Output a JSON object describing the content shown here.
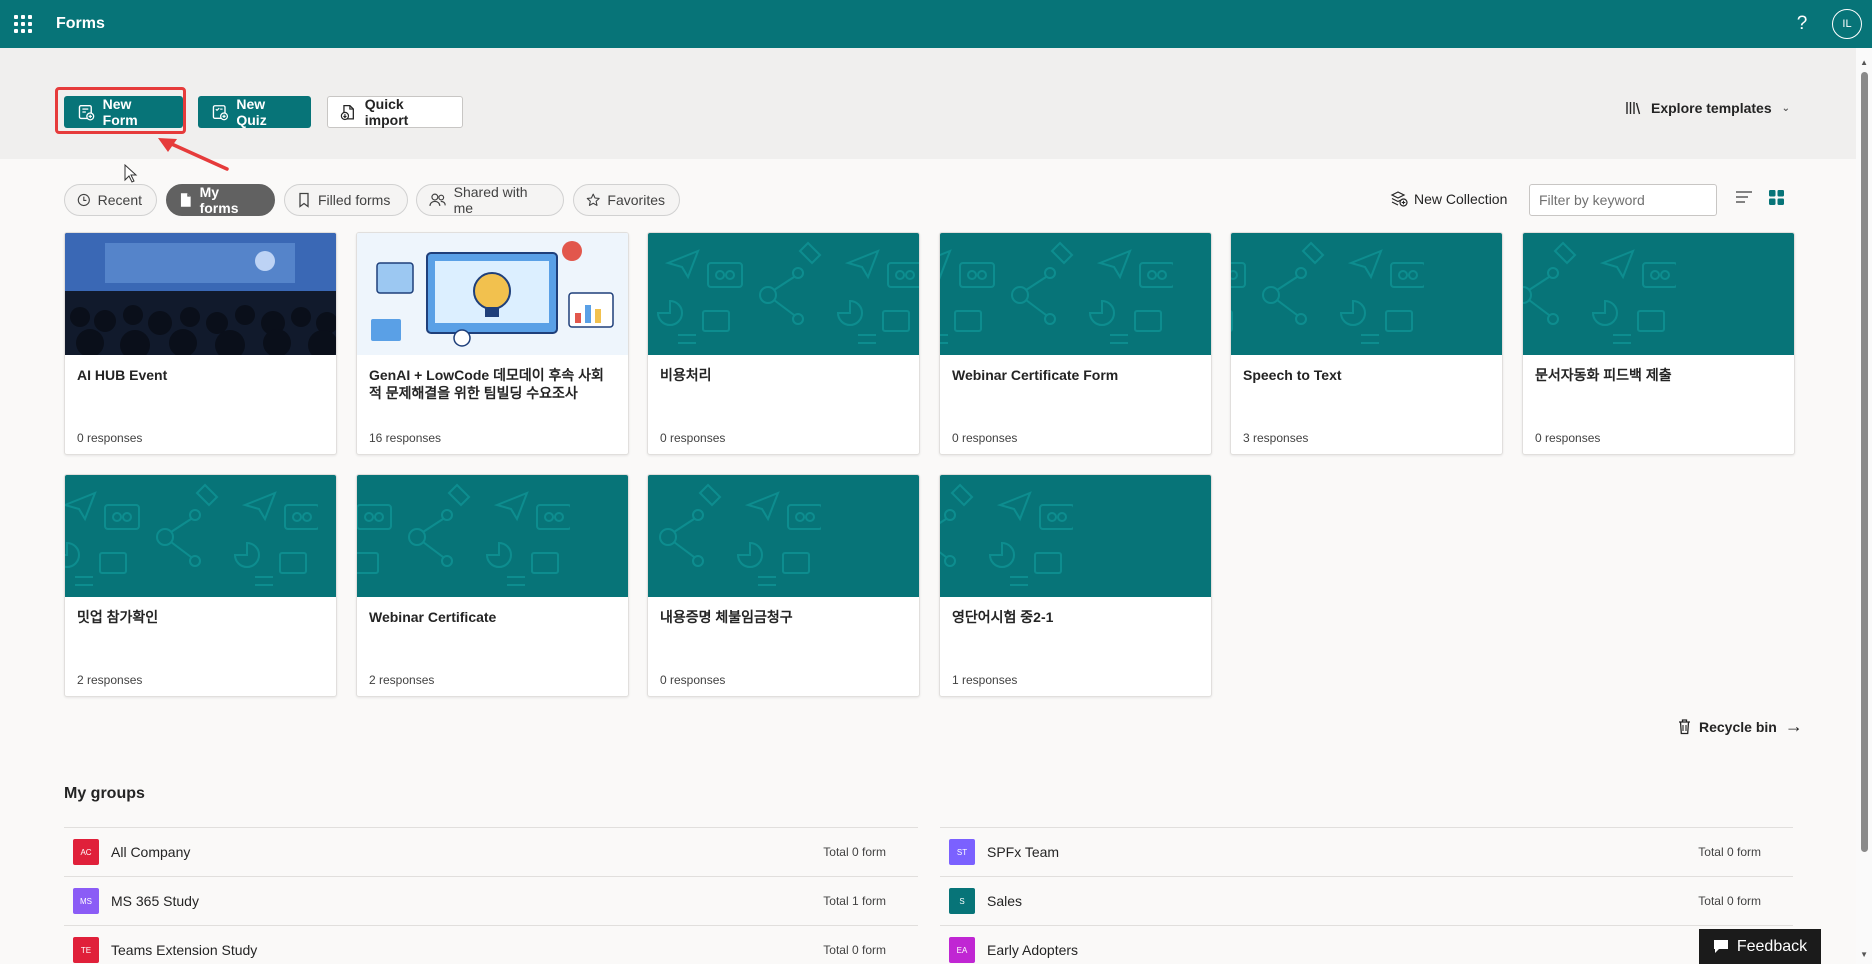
{
  "app": {
    "title": "Forms",
    "help": "?",
    "avatar_initials": "IL"
  },
  "actions": {
    "new_form": "New Form",
    "new_quiz": "New Quiz",
    "quick_import": "Quick import",
    "explore_templates": "Explore templates"
  },
  "filters": {
    "recent": "Recent",
    "my_forms": "My forms",
    "filled_forms": "Filled forms",
    "shared_with_me": "Shared with me",
    "favorites": "Favorites",
    "active": "My forms"
  },
  "collection": {
    "new_collection": "New Collection",
    "filter_placeholder": "Filter by keyword"
  },
  "cards": [
    {
      "title": "AI HUB Event",
      "responses": "0 responses"
    },
    {
      "title": "GenAI + LowCode 데모데이 후속 사회적 문제해결을 위한 팀빌딩 수요조사",
      "responses": "16 responses"
    },
    {
      "title": "비용처리",
      "responses": "0 responses"
    },
    {
      "title": "Webinar Certificate Form",
      "responses": "0 responses"
    },
    {
      "title": "Speech to Text",
      "responses": "3 responses"
    },
    {
      "title": "문서자동화 피드백 제출",
      "responses": "0 responses"
    },
    {
      "title": "밋업 참가확인",
      "responses": "2 responses"
    },
    {
      "title": "Webinar Certificate",
      "responses": "2 responses"
    },
    {
      "title": "내용증명 체불임금청구",
      "responses": "0 responses"
    },
    {
      "title": "영단어시험 중2-1",
      "responses": "1 responses"
    }
  ],
  "recycle_bin": "Recycle bin",
  "groups": {
    "title": "My groups",
    "items": [
      {
        "initials": "AC",
        "name": "All Company",
        "total": "Total 0 form",
        "color": "#e0203a"
      },
      {
        "initials": "ST",
        "name": "SPFx Team",
        "total": "Total 0 form",
        "color": "#7b61ff"
      },
      {
        "initials": "MS",
        "name": "MS 365 Study",
        "total": "Total 1 form",
        "color": "#8b5cf6"
      },
      {
        "initials": "S",
        "name": "Sales",
        "total": "Total 0 form",
        "color": "#077478"
      },
      {
        "initials": "TE",
        "name": "Teams Extension Study",
        "total": "Total 0 form",
        "color": "#e0203a"
      },
      {
        "initials": "EA",
        "name": "Early Adopters",
        "total": "",
        "color": "#c026d3"
      }
    ]
  },
  "feedback": "Feedback",
  "colors": {
    "brand": "#077478",
    "highlight": "#e63b3b"
  }
}
